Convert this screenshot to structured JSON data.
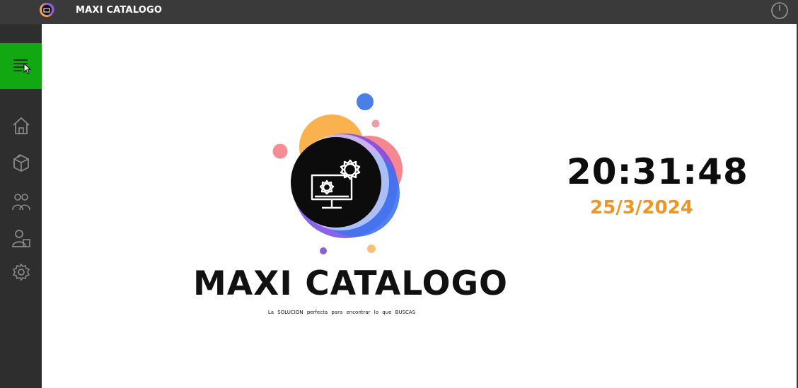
{
  "window": {
    "title": "MAXI CATALOGO"
  },
  "sidebar": {
    "menu_icon": "hamburger-menu-icon",
    "items": [
      {
        "icon": "home-icon"
      },
      {
        "icon": "box-icon"
      },
      {
        "icon": "users-icon"
      },
      {
        "icon": "user-edit-icon"
      },
      {
        "icon": "gear-icon"
      }
    ]
  },
  "main": {
    "brand_title": "MAXI CATALOGO",
    "brand_tagline": "La SOLUCION perfecta para encontrar lo que BUSCAS",
    "clock_time": "20:31:48",
    "clock_date": "25/3/2024"
  },
  "colors": {
    "accent": "#11a811",
    "date_color": "#f0951f",
    "titlebar": "#3a3a3a",
    "sidebar": "#2e2e2e"
  }
}
